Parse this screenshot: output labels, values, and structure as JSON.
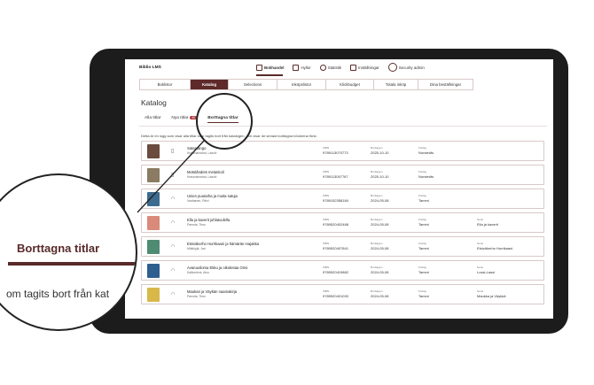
{
  "app": {
    "brand": "Biblio LMS"
  },
  "topnav": [
    {
      "label": "Bokhandel",
      "icon": "store-icon",
      "active": true
    },
    {
      "label": "Hyllor",
      "icon": "bookshelf-icon",
      "active": false
    },
    {
      "label": "Statistik",
      "icon": "chart-icon",
      "active": false
    },
    {
      "label": "Inställningar",
      "icon": "settings-icon",
      "active": false
    },
    {
      "label": "Security admin",
      "icon": "user-icon",
      "active": false
    }
  ],
  "tabs": [
    {
      "label": "Boklistor"
    },
    {
      "label": "Katalog",
      "active": true
    },
    {
      "label": "Selections"
    },
    {
      "label": "Inköpslistor"
    },
    {
      "label": "Klickbudget"
    },
    {
      "label": "Totala inköp"
    },
    {
      "label": "Dina beställningar"
    }
  ],
  "page": {
    "title": "Katalog",
    "subtabs": [
      {
        "label": "Alla titlar"
      },
      {
        "label": "Nya titlar",
        "badge": "40"
      },
      {
        "label": "Borttagna titlar",
        "active": true
      }
    ],
    "description": "Detta är en logg som visar alla titlar som tagits bort från katalogen, och visar de senast borttagna böckerna först."
  },
  "columns": {
    "isbn": "ISBN",
    "removed": "Borttagen",
    "publisher": "Förlag",
    "series": "Serie"
  },
  "rows": [
    {
      "title": "Satantango",
      "author": "Krasznahorkai, László",
      "type_icon": "book-icon",
      "isbn": "9789113070773",
      "removed": "2025-10-10",
      "publisher": "Norstedts",
      "series": "",
      "cover": "#6b4b3e"
    },
    {
      "title": "Motståndets melankoli",
      "author": "Krasznahorkai, László",
      "type_icon": "book-icon",
      "isbn": "9789113057767",
      "removed": "2025-10-10",
      "publisher": "Norstedts",
      "series": "",
      "cover": "#8a7b62"
    },
    {
      "title": "Unien puutarha ja muita satuja",
      "author": "Vanhanen, Päivi",
      "type_icon": "headphones-icon",
      "isbn": "9789152358184",
      "removed": "2024-05-08",
      "publisher": "Tammi",
      "series": "",
      "cover": "#3d6b8f"
    },
    {
      "title": "Ella ja kaverit juhlatuulella",
      "author": "Parvela, Timo",
      "type_icon": "headphones-icon",
      "isbn": "9789520402488",
      "removed": "2024-05-08",
      "publisher": "Tammi",
      "series": "Ella ja kaverit",
      "cover": "#d98a7a"
    },
    {
      "title": "Etsiväkerho Hurrikaani ja hämärän majakka",
      "author": "Mäkiöyjä, Jari",
      "type_icon": "headphones-icon",
      "isbn": "9789520407841",
      "removed": "2024-05-08",
      "publisher": "Tammi",
      "series": "Etsiväkerho Hurrikaani",
      "cover": "#4f8b72"
    },
    {
      "title": "Avaruusloma Ekku ja oikotietaa Onni",
      "author": "Kallioniemi, Aino",
      "type_icon": "headphones-icon",
      "isbn": "9789520419882",
      "removed": "2024-05-08",
      "publisher": "Tammi",
      "series": "Lossi-Lassi",
      "cover": "#2f5f8f"
    },
    {
      "title": "Maukan ja Väykän naamakirja",
      "author": "Parvela, Timo",
      "type_icon": "headphones-icon",
      "isbn": "9789520401030",
      "removed": "2024-05-08",
      "publisher": "Tammi",
      "series": "Maukka ja Väykkä",
      "cover": "#d9b84a"
    }
  ],
  "magnifier": {
    "title": "Borttagna titlar",
    "desc": "om tagits bort från kat"
  }
}
